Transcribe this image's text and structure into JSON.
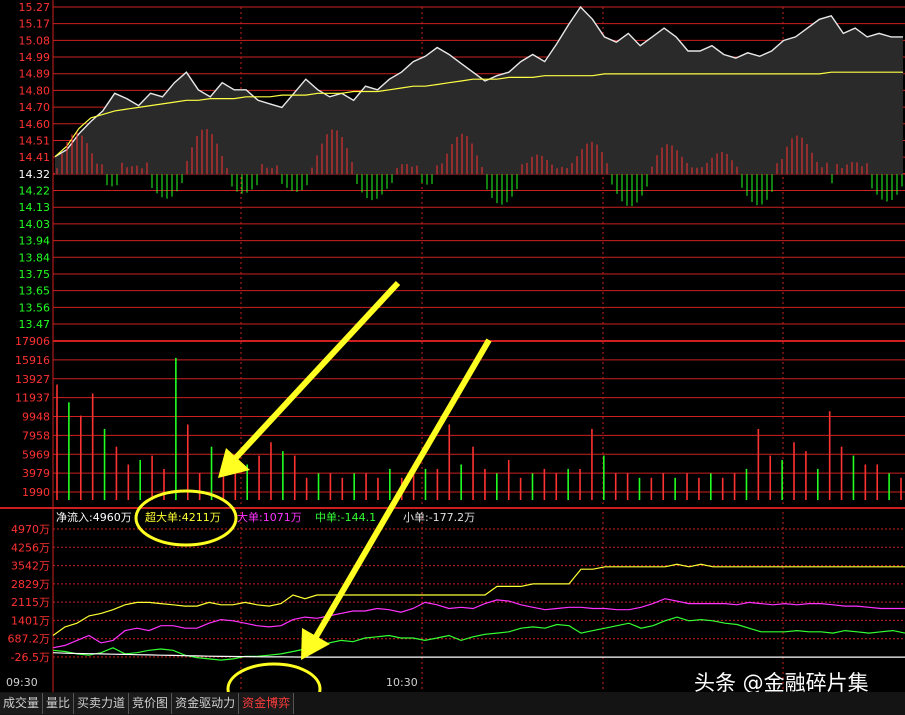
{
  "chart_data": [
    {
      "type": "line",
      "name_hint": "intraday-price",
      "price_axis_ticks": [
        "15.27",
        "15.17",
        "15.08",
        "14.99",
        "14.89",
        "14.80",
        "14.70",
        "14.60",
        "14.51",
        "14.41",
        "14.32",
        "14.22",
        "14.13",
        "14.03",
        "13.94",
        "13.84",
        "13.75",
        "13.65",
        "13.56",
        "13.47"
      ],
      "ylim": [
        13.42,
        15.27
      ],
      "reference_price": 14.32,
      "series": [
        {
          "values": [
            14.42,
            14.46,
            14.55,
            14.62,
            14.68,
            14.78,
            14.75,
            14.71,
            14.78,
            14.76,
            14.84,
            14.9,
            14.8,
            14.76,
            14.84,
            14.8,
            14.8,
            14.74,
            14.72,
            14.7,
            14.78,
            14.86,
            14.8,
            14.76,
            14.78,
            14.74,
            14.82,
            14.8,
            14.86,
            14.9,
            14.96,
            14.99,
            15.04,
            15.0,
            14.95,
            14.9,
            14.85,
            14.88,
            14.9,
            14.96,
            15.0,
            14.96,
            15.06,
            15.17,
            15.27,
            15.2,
            15.1,
            15.07,
            15.12,
            15.05,
            15.1,
            15.15,
            15.1,
            15.02,
            15.02,
            15.05,
            15.0,
            14.98,
            15.01,
            14.99,
            15.02,
            15.08,
            15.1,
            15.15,
            15.2,
            15.22,
            15.12,
            15.15,
            15.1,
            15.12,
            15.1,
            15.1
          ]
        },
        {
          "values": [
            14.42,
            14.48,
            14.58,
            14.64,
            14.66,
            14.68,
            14.69,
            14.7,
            14.71,
            14.72,
            14.73,
            14.74,
            14.74,
            14.75,
            14.75,
            14.75,
            14.76,
            14.76,
            14.76,
            14.77,
            14.77,
            14.77,
            14.78,
            14.78,
            14.78,
            14.79,
            14.79,
            14.79,
            14.8,
            14.81,
            14.82,
            14.82,
            14.83,
            14.84,
            14.85,
            14.86,
            14.86,
            14.86,
            14.87,
            14.87,
            14.87,
            14.88,
            14.88,
            14.88,
            14.88,
            14.88,
            14.89,
            14.89,
            14.89,
            14.89,
            14.89,
            14.89,
            14.89,
            14.89,
            14.89,
            14.89,
            14.89,
            14.89,
            14.89,
            14.89,
            14.89,
            14.89,
            14.89,
            14.89,
            14.89,
            14.9,
            14.9,
            14.9,
            14.9,
            14.9,
            14.9,
            14.9
          ]
        }
      ]
    },
    {
      "type": "bar",
      "name_hint": "volume",
      "axis_ticks": [
        "17906",
        "15916",
        "13927",
        "11937",
        "9948",
        "7958",
        "5969",
        "3979",
        "1990"
      ],
      "ylim": [
        0,
        17906
      ],
      "values": [
        13000,
        11000,
        9500,
        12000,
        8000,
        6000,
        4000,
        4500,
        5000,
        3500,
        16000,
        8500,
        3000,
        6000,
        4000,
        3500,
        4000,
        5000,
        6500,
        5500,
        5000,
        2500,
        3000,
        3000,
        2500,
        3000,
        3000,
        2500,
        3500,
        2500,
        4000,
        3500,
        3500,
        8500,
        4000,
        6000,
        3500,
        3000,
        4500,
        2500,
        3000,
        3500,
        3000,
        3500,
        3500,
        8000,
        5000,
        3000,
        3000,
        2500,
        2500,
        3000,
        2500,
        3000,
        2500,
        3000,
        2500,
        3000,
        3500,
        8000,
        5000,
        4500,
        6500,
        5500,
        3500,
        10000,
        6000,
        5000,
        4000,
        4000,
        3000,
        2500
      ]
    },
    {
      "type": "line",
      "name_hint": "capital-flow",
      "axis_ticks": [
        "4970万",
        "4256万",
        "3542万",
        "2829万",
        "2115万",
        "1401万",
        "687.2万",
        "-26.5万"
      ],
      "ylim": [
        -500,
        5200
      ],
      "summary": {
        "net_inflow": "净流入:4960万",
        "super_large": "超大单:4211万",
        "large": "大单:1071万",
        "medium": "中单:-144.1",
        "small": "小单:-177.2万"
      },
      "series": [
        {
          "color": "#ffff33",
          "values": [
            700,
            1050,
            1200,
            1500,
            1600,
            1750,
            1950,
            2050,
            2050,
            2000,
            1950,
            1900,
            1900,
            2050,
            1950,
            1950,
            2050,
            1950,
            1900,
            2000,
            2350,
            2200,
            2350,
            2350,
            2350,
            2350,
            2350,
            2350,
            2350,
            2350,
            2350,
            2350,
            2350,
            2350,
            2350,
            2350,
            2350,
            2700,
            2700,
            2700,
            2800,
            2800,
            2800,
            2800,
            3400,
            3400,
            3500,
            3500,
            3500,
            3500,
            3500,
            3500,
            3600,
            3500,
            3600,
            3500,
            3500,
            3500,
            3500,
            3500,
            3500,
            3500,
            3500,
            3500,
            3500,
            3500,
            3500,
            3500,
            3500,
            3500,
            3500,
            3500
          ]
        },
        {
          "color": "#ff33ff",
          "values": [
            200,
            300,
            500,
            700,
            400,
            500,
            900,
            1000,
            900,
            1100,
            1100,
            1000,
            1000,
            1200,
            1350,
            1300,
            1200,
            1100,
            1050,
            1100,
            1350,
            1450,
            1400,
            1500,
            1600,
            1700,
            1700,
            1800,
            1750,
            1650,
            1800,
            2050,
            1950,
            1800,
            1850,
            1800,
            2000,
            2150,
            2100,
            1950,
            1850,
            1750,
            1800,
            1850,
            1850,
            1800,
            1800,
            1750,
            1750,
            1850,
            2000,
            2200,
            2100,
            2000,
            2000,
            2000,
            2000,
            1950,
            2050,
            2000,
            1950,
            2000,
            1950,
            2000,
            2000,
            1950,
            1900,
            1900,
            1850,
            1800,
            1800,
            1800
          ]
        },
        {
          "color": "#33ff33",
          "values": [
            100,
            50,
            -50,
            -100,
            0,
            200,
            -50,
            0,
            100,
            150,
            100,
            -100,
            -200,
            -250,
            -300,
            -250,
            -150,
            -150,
            -100,
            -50,
            50,
            150,
            250,
            400,
            500,
            450,
            600,
            650,
            700,
            600,
            600,
            500,
            600,
            700,
            500,
            650,
            750,
            800,
            850,
            1000,
            1050,
            1000,
            1150,
            1100,
            800,
            900,
            1000,
            1100,
            1200,
            1000,
            1100,
            1300,
            1450,
            1300,
            1350,
            1300,
            1200,
            1150,
            1000,
            850,
            850,
            850,
            900,
            850,
            850,
            800,
            900,
            850,
            800,
            850,
            900,
            800
          ]
        },
        {
          "color": "#ffffff",
          "values": [
            0,
            -20,
            -30,
            -40,
            -50,
            -60,
            -70,
            -80,
            -90,
            -100,
            -110,
            -120,
            -130,
            -140,
            -150,
            -155,
            -160,
            -165,
            -170,
            -172,
            -175,
            -177,
            -177,
            -177,
            -177,
            -177,
            -177,
            -177,
            -177,
            -177,
            -177,
            -177,
            -177,
            -177,
            -177,
            -177,
            -177,
            -177,
            -177,
            -177,
            -177,
            -177,
            -177,
            -177,
            -177,
            -177,
            -177,
            -177,
            -177,
            -177,
            -177,
            -177,
            -177,
            -177,
            -177,
            -177,
            -177,
            -177,
            -177,
            -177,
            -177,
            -177,
            -177,
            -177,
            -177,
            -177,
            -177,
            -177,
            -177,
            -177,
            -177,
            -177
          ]
        }
      ]
    }
  ],
  "time_axis": {
    "start": "09:30",
    "mid": "10:30"
  },
  "tabs": [
    "成交量",
    "量比",
    "买卖力道",
    "竞价图",
    "资金驱动力",
    "资金博弈"
  ],
  "active_tab_index": 5,
  "watermark": "头条 @金融碎片集",
  "colors": {
    "up": "#ff3232",
    "down": "#22ff22",
    "grid": "#cc2020",
    "price_line": "#e8e8e8",
    "avg_line": "#ffff44",
    "annotation": "#ffff22"
  }
}
